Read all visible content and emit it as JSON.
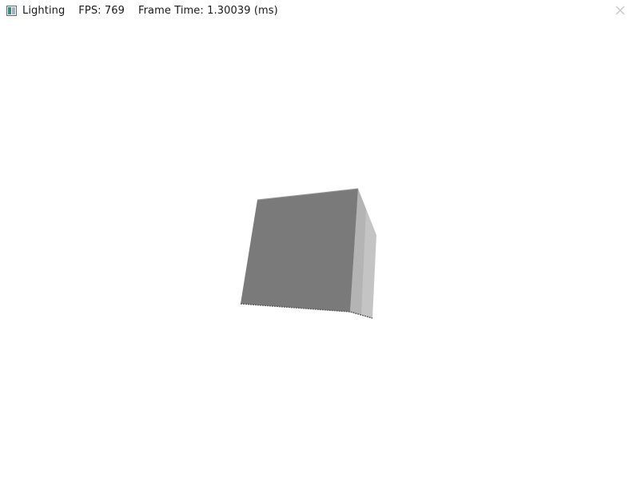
{
  "window": {
    "title": "Lighting",
    "fps_label": "FPS:",
    "fps_value": "769",
    "frame_time_label": "Frame Time:",
    "frame_time_value": "1.30039",
    "frame_time_unit": "(ms)"
  },
  "controls": {
    "close_icon": "close-icon"
  },
  "scene": {
    "object": "cube",
    "colors": {
      "front_face": "#7a7a7a",
      "side_face": "#c4c4c4",
      "top_edge": "#9a9a9a",
      "background": "#ffffff"
    }
  }
}
